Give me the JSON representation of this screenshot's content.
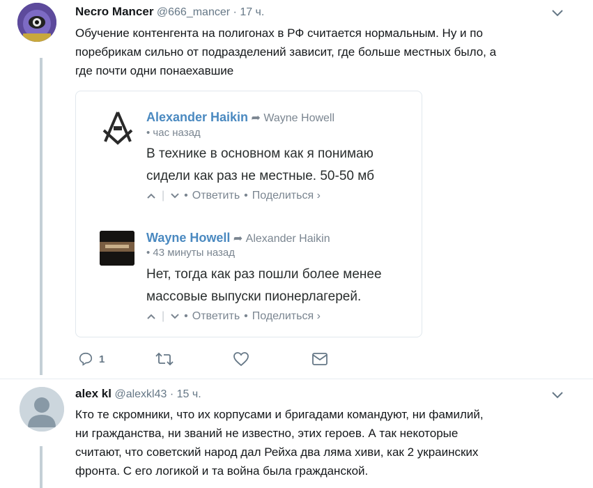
{
  "tweet1": {
    "name": "Necro Mancer",
    "handle": "@666_mancer",
    "sep": "·",
    "time": "17 ч.",
    "text_lines": [
      "Обучение контенгента на полигонах в РФ считается нормальным. Ну и по",
      "поребрикам сильно от подразделений зависит, где больше местных было, а",
      "где почти одни понаехавшие"
    ],
    "reply_count": "1"
  },
  "embed": {
    "comment1": {
      "author": "Alexander Haikin",
      "reply_to": "Wayne Howell",
      "time": "• час назад",
      "text_lines": [
        "В технике в основном как я понимаю",
        "сидели как раз не местные. 50-50 мб"
      ],
      "reply_label": "Ответить",
      "share_label": "Поделиться ›",
      "sep": "•"
    },
    "comment2": {
      "author": "Wayne Howell",
      "reply_to": "Alexander Haikin",
      "time": "• 43 минуты назад",
      "text_lines": [
        "Нет, тогда как раз пошли более менее",
        "массовые выпуски пионерлагерей."
      ],
      "reply_label": "Ответить",
      "share_label": "Поделиться ›",
      "sep": "•"
    }
  },
  "tweet2": {
    "name": "alex kl",
    "handle": "@alexkl43",
    "sep": "·",
    "time": "15 ч.",
    "text_lines": [
      "Кто те скромники, что их корпусами и бригадами командуют, ни фамилий,",
      "ни гражданства, ни званий не известно, этих героев. А так некоторые",
      "считают, что советский народ дал Рейха два  ляма хиви, как 2 украинских",
      "фронта. С его логикой и та война была гражданской."
    ]
  },
  "icons": [
    "chevron-down-icon",
    "reply-icon",
    "retweet-icon",
    "like-icon",
    "direct-message-icon",
    "upvote-icon",
    "downvote-icon",
    "reply-arrow-icon"
  ],
  "colors": {
    "link": "#4a89c0",
    "muted": "#657786",
    "thread": "#c4cfd6"
  }
}
